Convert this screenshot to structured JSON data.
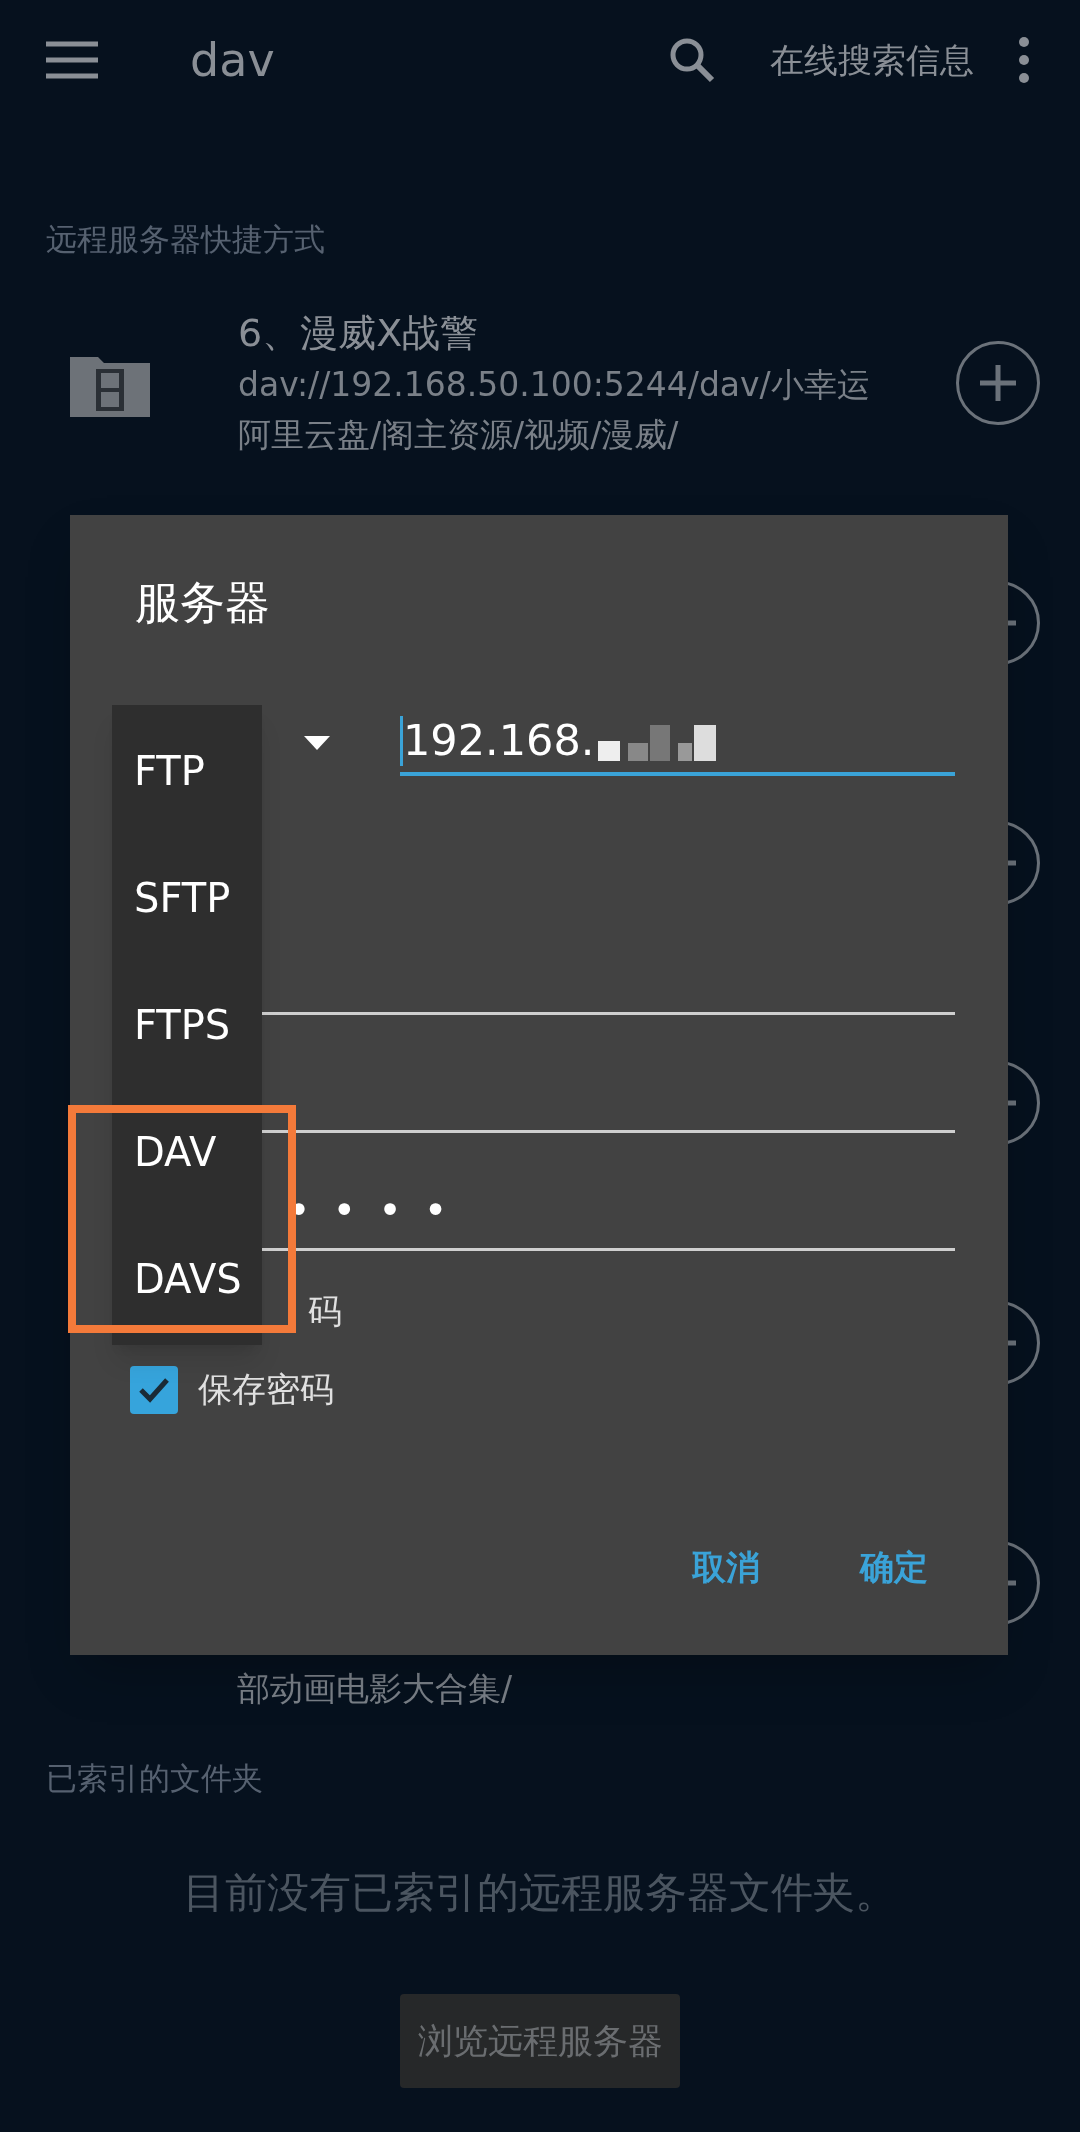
{
  "top_bar": {
    "title": "dav",
    "action": "在线搜索信息"
  },
  "shortcuts_section": {
    "heading": "远程服务器快捷方式",
    "items": [
      {
        "kind": "full",
        "title": "6、漫威X战警",
        "path_lines": [
          "dav://192.168.50.100:5244/dav/小幸运",
          "阿里云盘/阁主资源/视频/漫威/"
        ]
      },
      {
        "kind": "covered"
      },
      {
        "kind": "covered"
      },
      {
        "kind": "covered"
      },
      {
        "kind": "covered"
      },
      {
        "kind": "covered",
        "path_tail": "部动画电影大合集/"
      }
    ]
  },
  "indexed_section": {
    "heading": "已索引的文件夹",
    "empty_message": "目前没有已索引的远程服务器文件夹。",
    "browse_button": "浏览远程服务器"
  },
  "dialog": {
    "title": "服务器",
    "host_field": {
      "value": "192.168."
    },
    "fields": [
      {
        "kind": "plain"
      },
      {
        "kind": "plain"
      },
      {
        "kind": "password",
        "value": "••••"
      }
    ],
    "checkboxes": [
      {
        "label": "码"
      },
      {
        "label": "保存密码",
        "checked": true
      }
    ],
    "buttons": [
      "取消",
      "确定"
    ],
    "protocol_menu": {
      "items": [
        {
          "label": "FTP"
        },
        {
          "label": "SFTP"
        },
        {
          "label": "FTPS"
        },
        {
          "label": "DAV"
        },
        {
          "label": "DAVS"
        }
      ]
    }
  },
  "annotation": {
    "kind": "highlight_box"
  }
}
